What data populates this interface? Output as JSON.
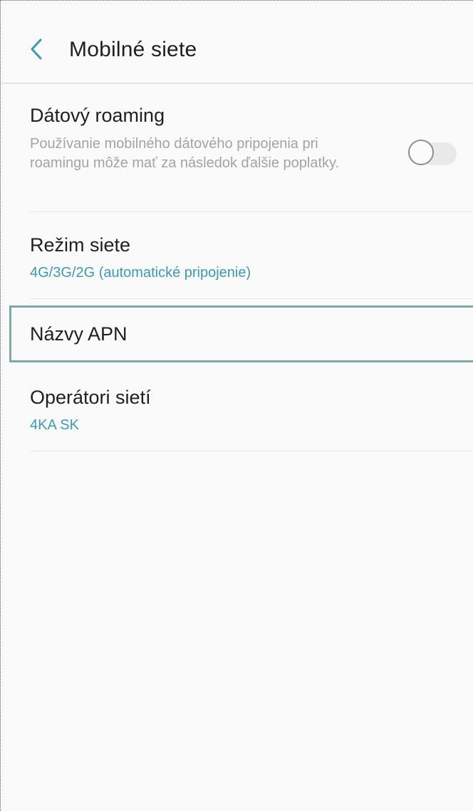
{
  "header": {
    "title": "Mobilné siete"
  },
  "settings": {
    "data_roaming": {
      "title": "Dátový roaming",
      "description": "Používanie mobilného dátového pripojenia pri roamingu môže mať za následok ďalšie poplatky.",
      "enabled": false
    },
    "network_mode": {
      "title": "Režim siete",
      "value": "4G/3G/2G (automatické pripojenie)"
    },
    "apn_names": {
      "title": "Názvy APN",
      "focused": true
    },
    "network_operators": {
      "title": "Operátori sietí",
      "value": "4KA SK"
    }
  },
  "colors": {
    "accent": "#3a9ab5",
    "focus_outline": "#7ea9a6",
    "background": "#fafafa"
  }
}
